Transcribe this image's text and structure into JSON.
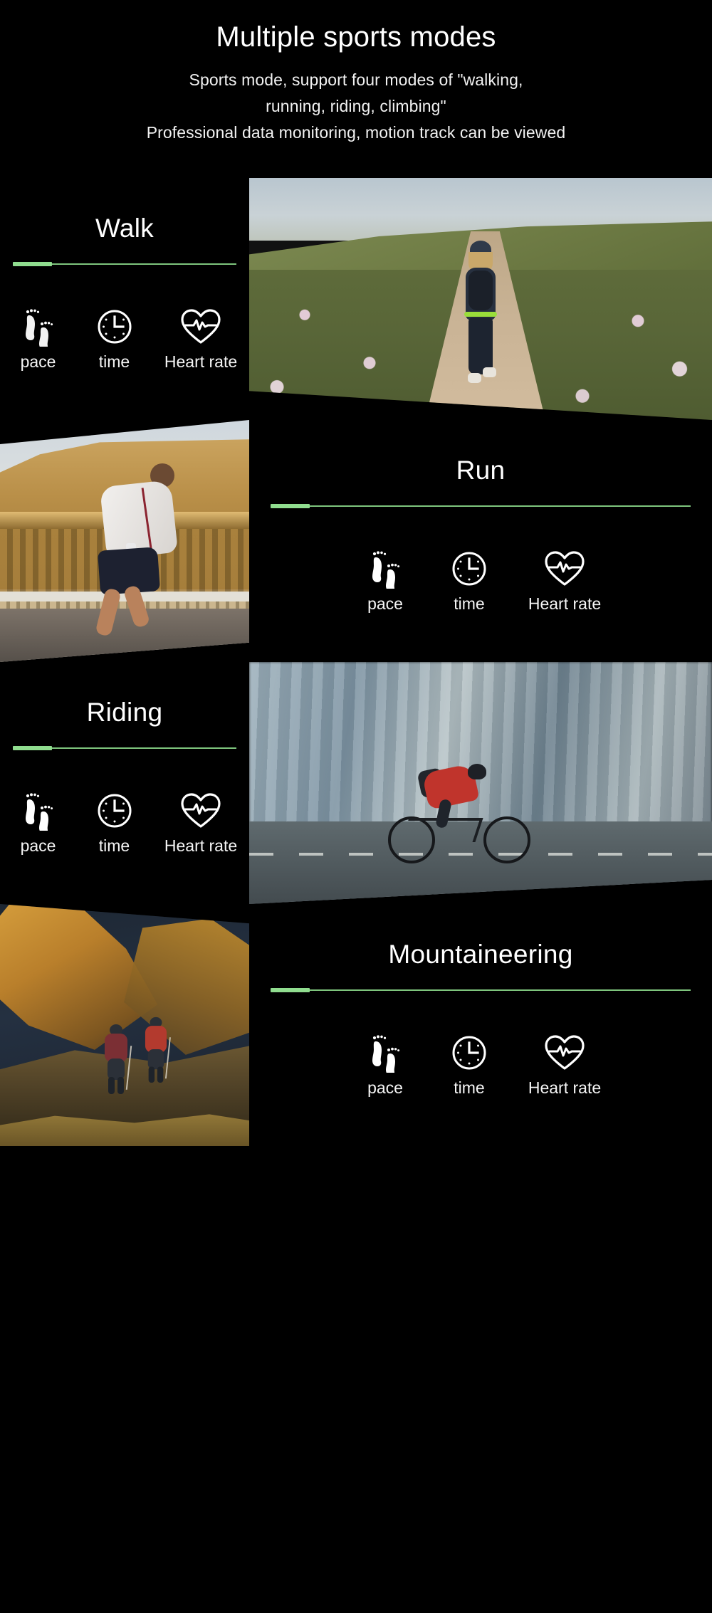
{
  "header": {
    "title": "Multiple sports modes",
    "subtitle_lines": [
      "Sports mode, support four modes of \"walking,",
      "running, riding, climbing\"",
      "Professional data monitoring, motion track can be viewed"
    ]
  },
  "theme": {
    "background": "#000000",
    "text": "#ffffff",
    "accent_green": "#90dd8f",
    "divider_line": "#7ec57d"
  },
  "metric_labels": {
    "pace": "pace",
    "time": "time",
    "heart_rate": "Heart rate"
  },
  "icons": {
    "pace": "footprints-icon",
    "time": "clock-icon",
    "heart_rate": "heart-pulse-icon"
  },
  "sections": [
    {
      "id": "walk",
      "title": "Walk",
      "layout": "text-left",
      "image_alt": "woman hiking on sandy trail through pink wildflowers",
      "metrics": [
        {
          "label": "pace",
          "icon": "footprints-icon"
        },
        {
          "label": "time",
          "icon": "clock-icon"
        },
        {
          "label": "Heart rate",
          "icon": "heart-pulse-icon"
        }
      ]
    },
    {
      "id": "run",
      "title": "Run",
      "layout": "text-right",
      "image_alt": "man running past a classical stone building at golden hour",
      "metrics": [
        {
          "label": "pace",
          "icon": "footprints-icon"
        },
        {
          "label": "time",
          "icon": "clock-icon"
        },
        {
          "label": "Heart rate",
          "icon": "heart-pulse-icon"
        }
      ]
    },
    {
      "id": "riding",
      "title": "Riding",
      "layout": "text-left",
      "image_alt": "cyclist riding through a motion-blurred city street",
      "metrics": [
        {
          "label": "pace",
          "icon": "footprints-icon"
        },
        {
          "label": "time",
          "icon": "clock-icon"
        },
        {
          "label": "Heart rate",
          "icon": "heart-pulse-icon"
        }
      ]
    },
    {
      "id": "mountaineering",
      "title": "Mountaineering",
      "layout": "text-right",
      "image_alt": "two hikers with backpacks climbing a golden rocky mountain slope",
      "metrics": [
        {
          "label": "pace",
          "icon": "footprints-icon"
        },
        {
          "label": "time",
          "icon": "clock-icon"
        },
        {
          "label": "Heart rate",
          "icon": "heart-pulse-icon"
        }
      ]
    }
  ]
}
